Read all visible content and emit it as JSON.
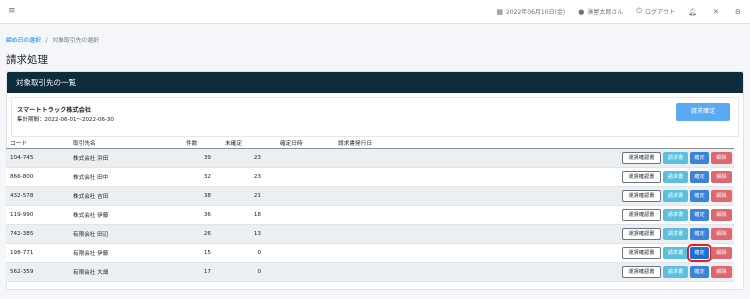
{
  "topbar": {
    "menu_icon": "≡",
    "date": "2022年06月10日(金)",
    "user": "湊屋太郎さん",
    "logout": "ログアウト"
  },
  "breadcrumb": {
    "link": "締め日の選択",
    "separator": "/",
    "current": "対象取引先の選択"
  },
  "page_title": "請求処理",
  "card": {
    "header": "対象取引先の一覧",
    "company": "スマートトラック株式会社",
    "period": "集計期間：2022-06-01〜2022-06-30",
    "confirm_all": "請求確定"
  },
  "table": {
    "headers": [
      "コード",
      "取引先名",
      "件数",
      "未確定",
      "確定日時",
      "請求書発行日"
    ],
    "buttons": {
      "detail": "運賃確認書",
      "invoice": "請求書",
      "confirm": "確定",
      "cancel": "解除"
    },
    "rows": [
      {
        "code": "104-745",
        "name": "株式会社 浜田",
        "count": "39",
        "unconfirmed": "23"
      },
      {
        "code": "866-800",
        "name": "株式会社 田中",
        "count": "32",
        "unconfirmed": "23"
      },
      {
        "code": "432-578",
        "name": "株式会社 吉田",
        "count": "38",
        "unconfirmed": "21"
      },
      {
        "code": "119-990",
        "name": "株式会社 伊藤",
        "count": "36",
        "unconfirmed": "18"
      },
      {
        "code": "742-385",
        "name": "有限会社 田辺",
        "count": "26",
        "unconfirmed": "13"
      },
      {
        "code": "198-771",
        "name": "有限会社 伊藤",
        "count": "15",
        "unconfirmed": "0"
      },
      {
        "code": "562-359",
        "name": "有限会社 大畑",
        "count": "17",
        "unconfirmed": "0"
      }
    ]
  },
  "colors": {
    "header_bg": "#0d2c3c",
    "primary": "#3b82d9",
    "info": "#5bc0de",
    "danger": "#e0666f",
    "highlight": "#e02020"
  }
}
